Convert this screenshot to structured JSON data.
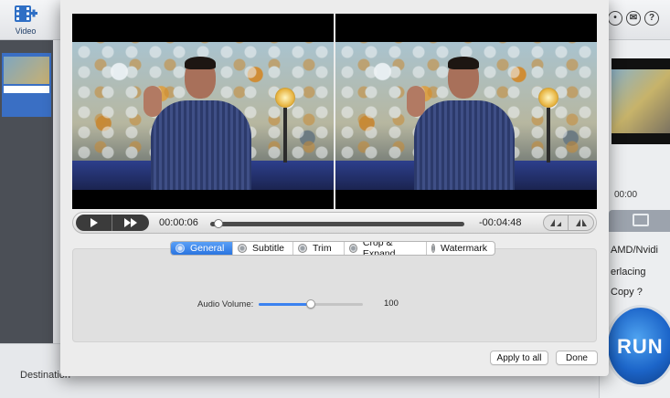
{
  "app": {
    "toolbar": {
      "video_label": "Video"
    },
    "right_panel": {
      "time": "00:00",
      "options": [
        "AMD/Nvidi",
        "erlacing",
        "Copy ?"
      ],
      "run_label": "RUN"
    },
    "bottom": {
      "destination_label": "Destination"
    }
  },
  "player": {
    "current_time": "00:00:06",
    "remaining_time": "-00:04:48",
    "progress": 0.02
  },
  "tabs": [
    {
      "label": "General",
      "active": true
    },
    {
      "label": "Subtitle",
      "active": false
    },
    {
      "label": "Trim",
      "active": false
    },
    {
      "label": "Crop & Expand",
      "active": false
    },
    {
      "label": "Watermark",
      "active": false
    }
  ],
  "general": {
    "audio_volume_label": "Audio Volume:",
    "audio_volume_value": "100",
    "audio_volume_fraction": 0.5
  },
  "buttons": {
    "apply_to_all": "Apply to all",
    "done": "Done"
  },
  "colors": {
    "accent": "#2a74e0",
    "run": "#1c65c9"
  }
}
